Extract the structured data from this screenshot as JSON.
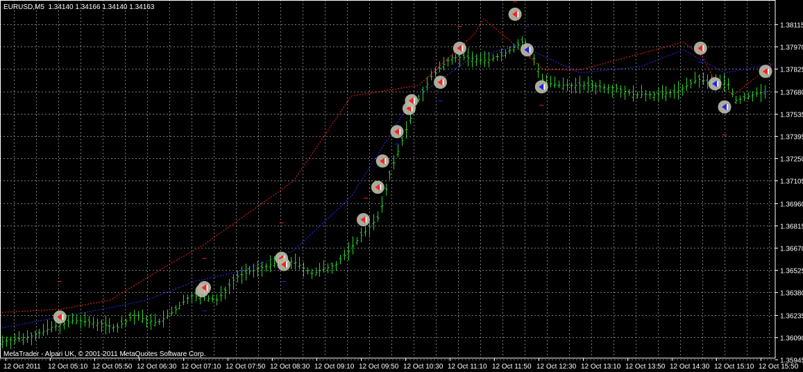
{
  "window": {
    "symbol": "EURUSD,M5",
    "ohlc": "1.34140 1.34166 1.34140 1.34163"
  },
  "copyright": "MetaTrader - Alpari UK, © 2001-2011 MetaQuotes Software Corp.",
  "colors": {
    "background": "#000000",
    "grid": "#7a7a7a",
    "frame": "#ffffff",
    "bars": "#2fd02f",
    "upper_line": "#ff2020",
    "lower_line": "#3030ff",
    "marker_halo": "#b8b8a8",
    "marker_red": "#ff2020",
    "marker_blue": "#2020ff"
  },
  "chart_data": {
    "type": "bar",
    "title": "",
    "price_axis": {
      "ticks": [
        "1.38115",
        "1.37970",
        "1.37825",
        "1.37680",
        "1.37535",
        "1.37395",
        "1.37250",
        "1.37105",
        "1.36960",
        "1.36815",
        "1.36670",
        "1.36525",
        "1.36380",
        "1.36235",
        "1.36090",
        "1.35945"
      ],
      "ylim": [
        1.3593,
        1.3819
      ]
    },
    "time_axis": {
      "ticks": [
        "12 Oct 2011",
        "12 Oct 05:10",
        "12 Oct 05:50",
        "12 Oct 06:30",
        "12 Oct 07:10",
        "12 Oct 07:50",
        "12 Oct 08:30",
        "12 Oct 09:10",
        "12 Oct 09:50",
        "12 Oct 10:30",
        "12 Oct 11:10",
        "12 Oct 11:50",
        "12 Oct 12:30",
        "12 Oct 13:10",
        "12 Oct 13:50",
        "12 Oct 14:30",
        "12 Oct 15:10",
        "12 Oct 15:50"
      ]
    },
    "bar_count": 186,
    "close_path": [
      [
        0,
        1.3606
      ],
      [
        13,
        1.361
      ],
      [
        22,
        1.3616
      ],
      [
        30,
        1.362
      ],
      [
        40,
        1.3618
      ],
      [
        48,
        1.3615
      ],
      [
        55,
        1.3623
      ],
      [
        65,
        1.3618
      ],
      [
        72,
        1.3626
      ],
      [
        79,
        1.3636
      ],
      [
        90,
        1.3633
      ],
      [
        98,
        1.3648
      ],
      [
        105,
        1.3652
      ],
      [
        117,
        1.3658
      ],
      [
        122,
        1.3658
      ],
      [
        130,
        1.365
      ],
      [
        140,
        1.3656
      ],
      [
        145,
        1.3664
      ],
      [
        150,
        1.3674
      ],
      [
        158,
        1.3687
      ],
      [
        162,
        1.3712
      ],
      [
        173,
        1.3758
      ],
      [
        180,
        1.3778
      ],
      [
        188,
        1.379
      ],
      [
        195,
        1.379
      ],
      [
        203,
        1.3788
      ],
      [
        210,
        1.3792
      ],
      [
        218,
        1.38
      ],
      [
        223,
        1.379
      ],
      [
        227,
        1.3774
      ],
      [
        233,
        1.3772
      ],
      [
        245,
        1.3772
      ],
      [
        258,
        1.377
      ],
      [
        265,
        1.3766
      ],
      [
        276,
        1.3766
      ],
      [
        283,
        1.3768
      ],
      [
        292,
        1.3776
      ],
      [
        296,
        1.3774
      ],
      [
        304,
        1.3774
      ],
      [
        308,
        1.3762
      ],
      [
        315,
        1.3766
      ],
      [
        320,
        1.3768
      ]
    ],
    "upper_line": [
      [
        0,
        1.3625
      ],
      [
        24,
        1.3627
      ],
      [
        45,
        1.3633
      ],
      [
        66,
        1.3653
      ],
      [
        83,
        1.3668
      ],
      [
        121,
        1.371
      ],
      [
        145,
        1.3765
      ],
      [
        173,
        1.3772
      ],
      [
        196,
        1.3805
      ],
      [
        200,
        1.3815
      ],
      [
        210,
        1.3802
      ],
      [
        225,
        1.3782
      ],
      [
        240,
        1.3782
      ],
      [
        283,
        1.38
      ],
      [
        291,
        1.379
      ],
      [
        297,
        1.3772
      ],
      [
        304,
        1.3766
      ],
      [
        320,
        1.3786
      ]
    ],
    "lower_line": [
      [
        0,
        1.3615
      ],
      [
        24,
        1.3622
      ],
      [
        45,
        1.3628
      ],
      [
        60,
        1.3633
      ],
      [
        80,
        1.3645
      ],
      [
        100,
        1.3652
      ],
      [
        121,
        1.3665
      ],
      [
        145,
        1.37
      ],
      [
        170,
        1.3762
      ],
      [
        195,
        1.379
      ],
      [
        215,
        1.3798
      ],
      [
        240,
        1.378
      ],
      [
        265,
        1.3784
      ],
      [
        283,
        1.3795
      ],
      [
        300,
        1.378
      ],
      [
        320,
        1.3786
      ]
    ],
    "markers": [
      {
        "t": 24,
        "price": 1.3622,
        "color": "red"
      },
      {
        "t": 83,
        "price": 1.3639,
        "color": "red"
      },
      {
        "t": 84,
        "price": 1.3641,
        "color": "red"
      },
      {
        "t": 116,
        "price": 1.366,
        "color": "red"
      },
      {
        "t": 117,
        "price": 1.3656,
        "color": "red"
      },
      {
        "t": 150,
        "price": 1.3685,
        "color": "red"
      },
      {
        "t": 156,
        "price": 1.3706,
        "color": "red"
      },
      {
        "t": 158,
        "price": 1.3723,
        "color": "red"
      },
      {
        "t": 164,
        "price": 1.3742,
        "color": "red"
      },
      {
        "t": 169,
        "price": 1.3757,
        "color": "red"
      },
      {
        "t": 170,
        "price": 1.3762,
        "color": "red"
      },
      {
        "t": 182,
        "price": 1.3774,
        "color": "red"
      },
      {
        "t": 190,
        "price": 1.3796,
        "color": "red"
      },
      {
        "t": 213,
        "price": 1.3818,
        "color": "red"
      },
      {
        "t": 218,
        "price": 1.3795,
        "color": "blue"
      },
      {
        "t": 224,
        "price": 1.3771,
        "color": "blue"
      },
      {
        "t": 290,
        "price": 1.3796,
        "color": "red"
      },
      {
        "t": 296,
        "price": 1.3773,
        "color": "blue"
      },
      {
        "t": 300,
        "price": 1.3758,
        "color": "blue"
      },
      {
        "t": 317,
        "price": 1.3781,
        "color": "red"
      }
    ],
    "dashes": [
      {
        "t": 24,
        "price": 1.3645,
        "color": "red"
      },
      {
        "t": 84,
        "price": 1.366,
        "color": "red"
      },
      {
        "t": 84,
        "price": 1.3626,
        "color": "blue"
      },
      {
        "t": 116,
        "price": 1.3683,
        "color": "red"
      },
      {
        "t": 117,
        "price": 1.3645,
        "color": "blue"
      },
      {
        "t": 151,
        "price": 1.3699,
        "color": "red"
      },
      {
        "t": 164,
        "price": 1.3734,
        "color": "blue"
      },
      {
        "t": 182,
        "price": 1.3762,
        "color": "blue"
      },
      {
        "t": 190,
        "price": 1.381,
        "color": "red"
      },
      {
        "t": 213,
        "price": 1.3826,
        "color": "red"
      },
      {
        "t": 218,
        "price": 1.381,
        "color": "blue"
      },
      {
        "t": 224,
        "price": 1.3759,
        "color": "red"
      },
      {
        "t": 290,
        "price": 1.3787,
        "color": "blue"
      },
      {
        "t": 300,
        "price": 1.374,
        "color": "red"
      },
      {
        "t": 317,
        "price": 1.3768,
        "color": "blue"
      }
    ]
  }
}
